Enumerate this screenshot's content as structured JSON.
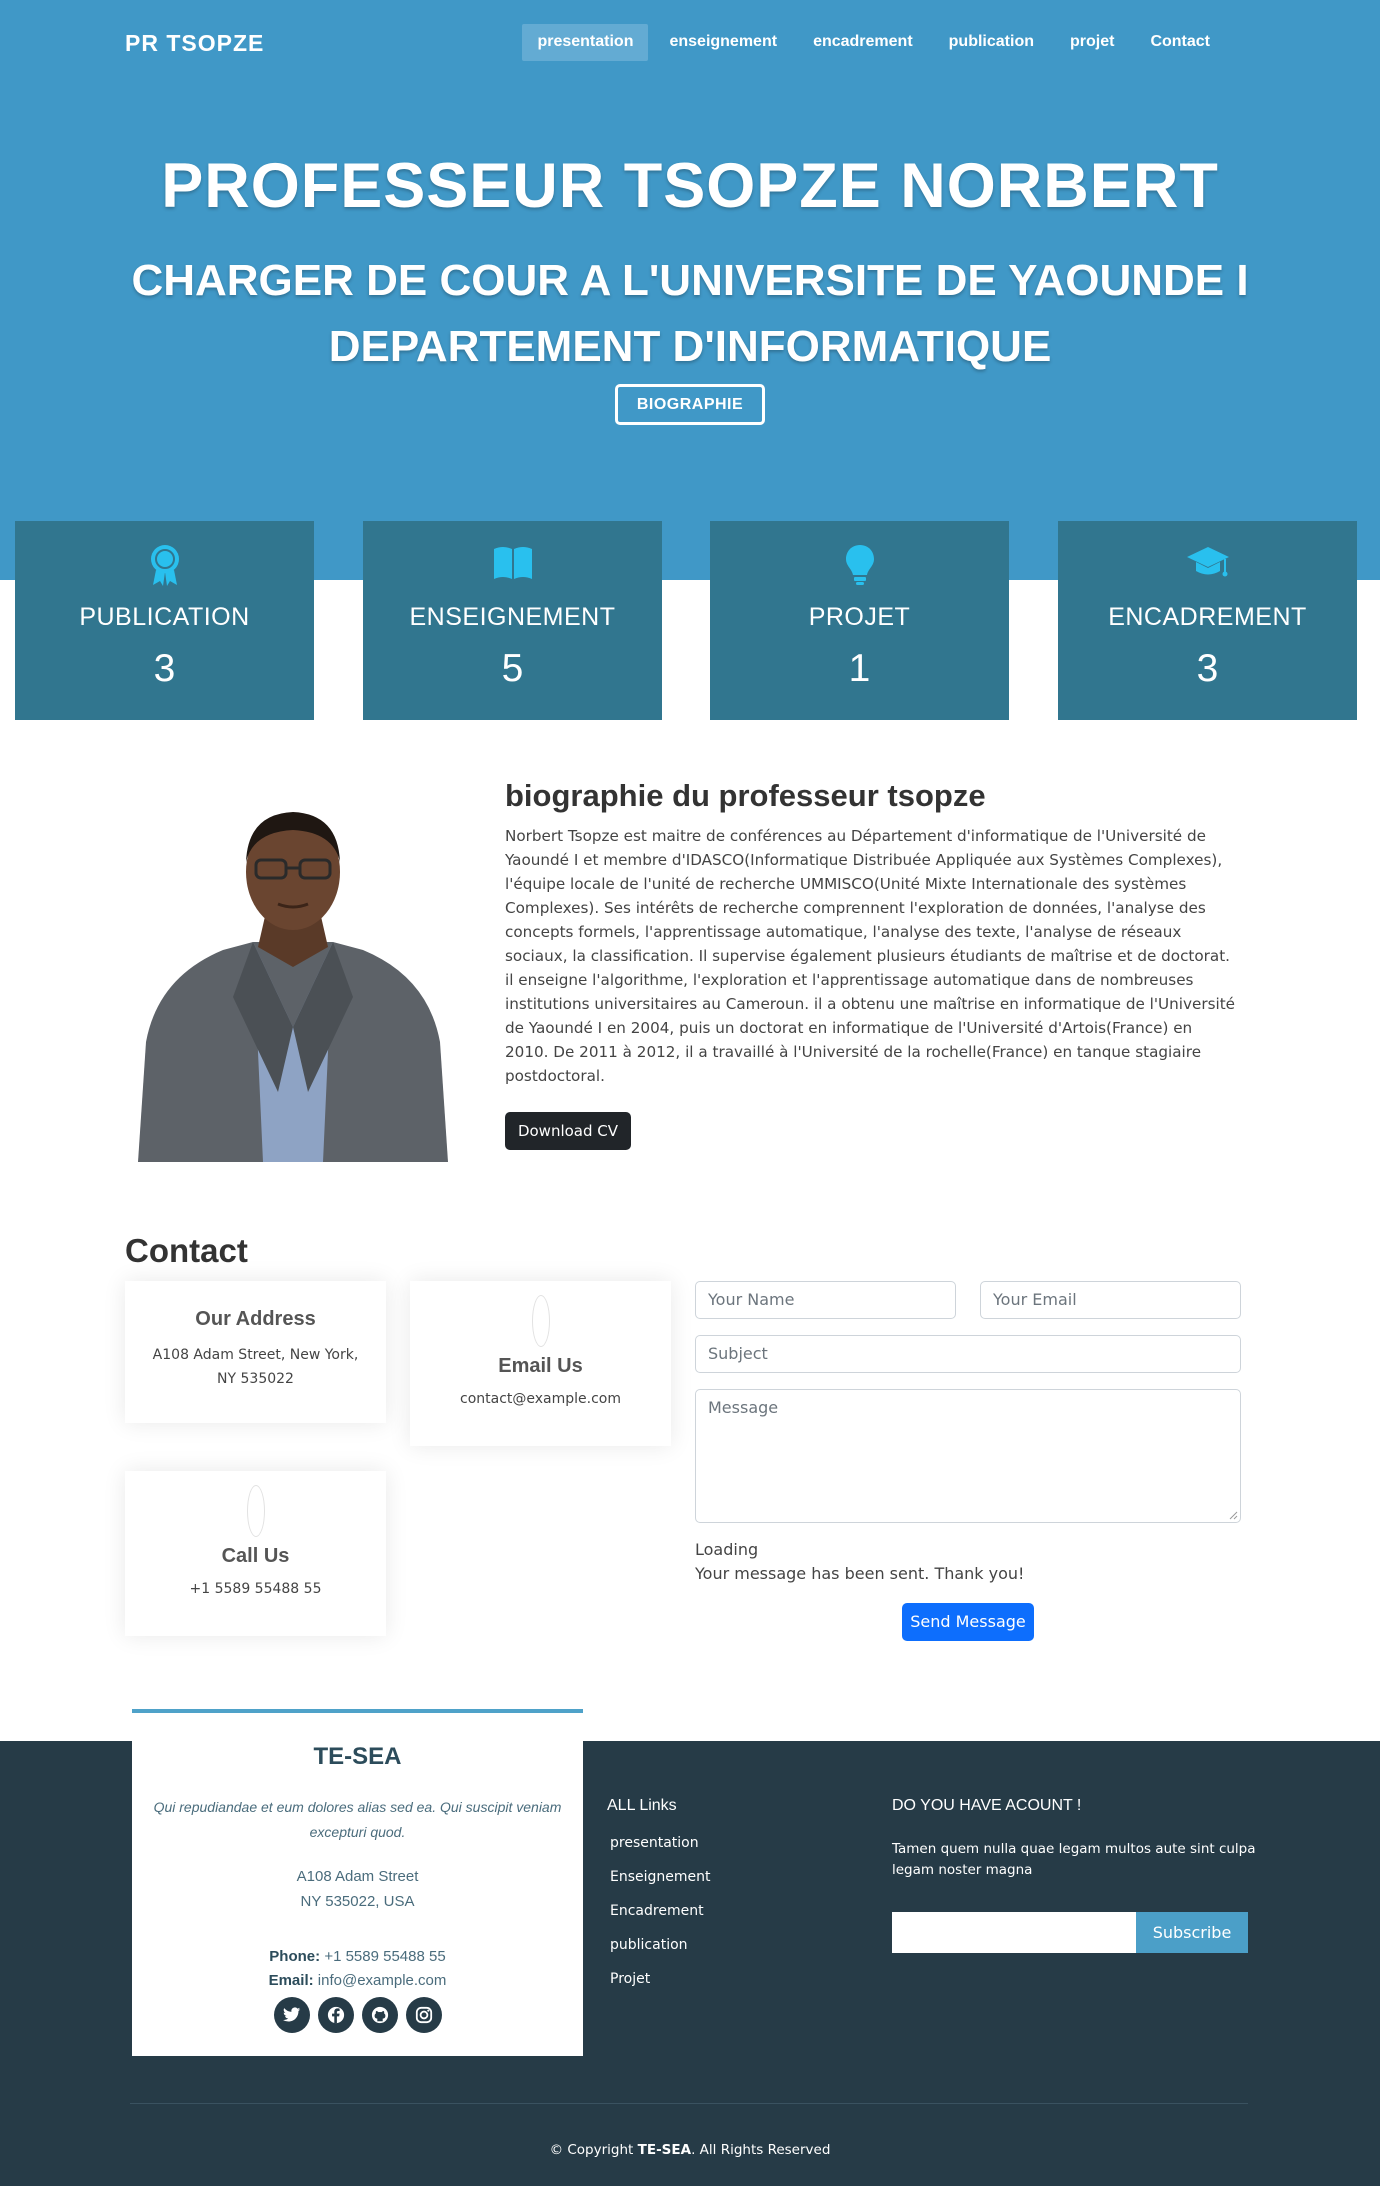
{
  "nav": {
    "logo": "PR TSOPZE",
    "links": [
      "presentation",
      "enseignement",
      "encadrement",
      "publication",
      "projet",
      "Contact"
    ],
    "active_index": 0
  },
  "hero": {
    "title": "PROFESSEUR TSOPZE NORBERT",
    "subtitle_line1": "CHARGER DE COUR A L'UNIVERSITE DE YAOUNDE I",
    "subtitle_line2": "DEPARTEMENT D'INFORMATIQUE",
    "button": "BIOGRAPHIE"
  },
  "stats": [
    {
      "icon": "award-icon",
      "label": "PUBLICATION",
      "value": "3"
    },
    {
      "icon": "book-icon",
      "label": "ENSEIGNEMENT",
      "value": "5"
    },
    {
      "icon": "lightbulb-icon",
      "label": "PROJET",
      "value": "1"
    },
    {
      "icon": "graduation-cap-icon",
      "label": "ENCADREMENT",
      "value": "3"
    }
  ],
  "biography": {
    "title": "biographie du professeur tsopze",
    "text": "Norbert Tsopze est maitre de conférences au Département d'informatique de l'Université de Yaoundé I et membre d'IDASCO(Informatique Distribuée Appliquée aux Systèmes Complexes), l'équipe locale de l'unité de recherche UMMISCO(Unité Mixte Internationale des systèmes Complexes). Ses intérêts de recherche comprennent l'exploration de données, l'analyse des concepts formels, l'apprentissage automatique, l'analyse des texte, l'analyse de réseaux sociaux, la classification. Il supervise également plusieurs étudiants de maîtrise et de doctorat. il enseigne l'algorithme, l'exploration et l'apprentissage automatique dans de nombreuses institutions universitaires au Cameroun. il a obtenu une maîtrise en informatique de l'Université de Yaoundé I en 2004, puis un doctorat en informatique de l'Université d'Artois(France) en 2010. De 2011 à 2012, il a travaillé à l'Université de la rochelle(France) en tanque stagiaire postdoctoral.",
    "cv_button": "Download CV"
  },
  "contact": {
    "title": "Contact",
    "address": {
      "title": "Our Address",
      "text": "A108 Adam Street, New York, NY 535022"
    },
    "email": {
      "title": "Email Us",
      "text": "contact@example.com"
    },
    "phone": {
      "title": "Call Us",
      "text": "+1 5589 55488 55"
    },
    "form": {
      "name_placeholder": "Your Name",
      "email_placeholder": "Your Email",
      "subject_placeholder": "Subject",
      "message_placeholder": "Message",
      "loading": "Loading",
      "sent": "Your message has been sent. Thank you!",
      "send_button": "Send Message"
    }
  },
  "footer": {
    "brand": "TE-SEA",
    "description": "Qui repudiandae et eum dolores alias sed ea. Qui suscipit veniam excepturi quod.",
    "address_line1": "A108 Adam Street",
    "address_line2": "NY 535022, USA",
    "phone_label": "Phone:",
    "phone": "+1 5589 55488 55",
    "email_label": "Email:",
    "email": "info@example.com",
    "socials": [
      "twitter-icon",
      "facebook-icon",
      "github-icon",
      "instagram-icon"
    ],
    "links_title": "ALL Links",
    "links": [
      "presentation",
      "Enseignement",
      "Encadrement",
      "publication",
      "Projet"
    ],
    "account_title": "DO YOU HAVE ACOUNT !",
    "account_text": "Tamen quem nulla quae legam multos aute sint culpa legam noster magna",
    "subscribe_button": "Subscribe",
    "copyright_prefix": "© Copyright",
    "copyright_brand": "TE-SEA",
    "copyright_suffix": ". All Rights Reserved"
  },
  "colors": {
    "hero_bg": "#4098c7",
    "stat_card_bg": "#31768f",
    "stat_icon": "#29c0ee",
    "footer_bg": "#263b47",
    "send_button": "#0d6efd",
    "subscribe_button": "#4b9fc8"
  }
}
